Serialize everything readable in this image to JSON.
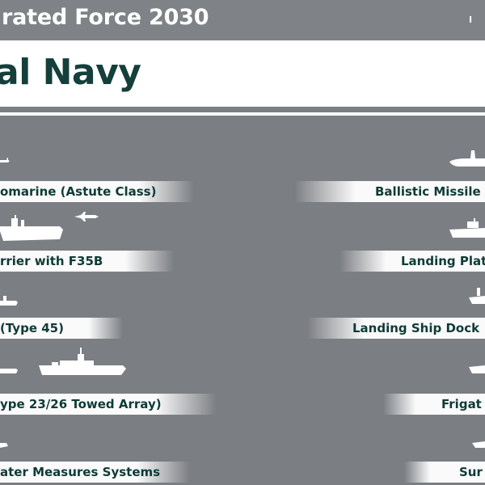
{
  "header": {
    "title": "rated Force 2030",
    "right_text": "I"
  },
  "banner": {
    "title": "al Navy"
  },
  "capabilities": {
    "left": [
      {
        "label": "omarine (Astute Class)",
        "icon": "submarine-icon"
      },
      {
        "label": "rrier with F35B",
        "icon": "aircraft-carrier-icon"
      },
      {
        "label": "(Type 45)",
        "icon": "destroyer-icon"
      },
      {
        "label": "ype 23/26 Towed Array)",
        "icon": "frigate-icon"
      },
      {
        "label": "ater Measures Systems",
        "icon": "mine-countermeasures-icon"
      }
    ],
    "right": [
      {
        "label": "Ballistic Missile",
        "icon": "ballistic-missile-submarine-icon"
      },
      {
        "label": "Landing Plat",
        "icon": "landing-platform-icon"
      },
      {
        "label": "Landing Ship Dock",
        "icon": "landing-ship-dock-icon"
      },
      {
        "label": "Frigat",
        "icon": "frigate-icon"
      },
      {
        "label": "Sur",
        "icon": "survey-ship-icon"
      }
    ]
  },
  "colors": {
    "background": "#7b7e83",
    "banner_text": "#143f3a",
    "label_text": "#0e3b36"
  }
}
